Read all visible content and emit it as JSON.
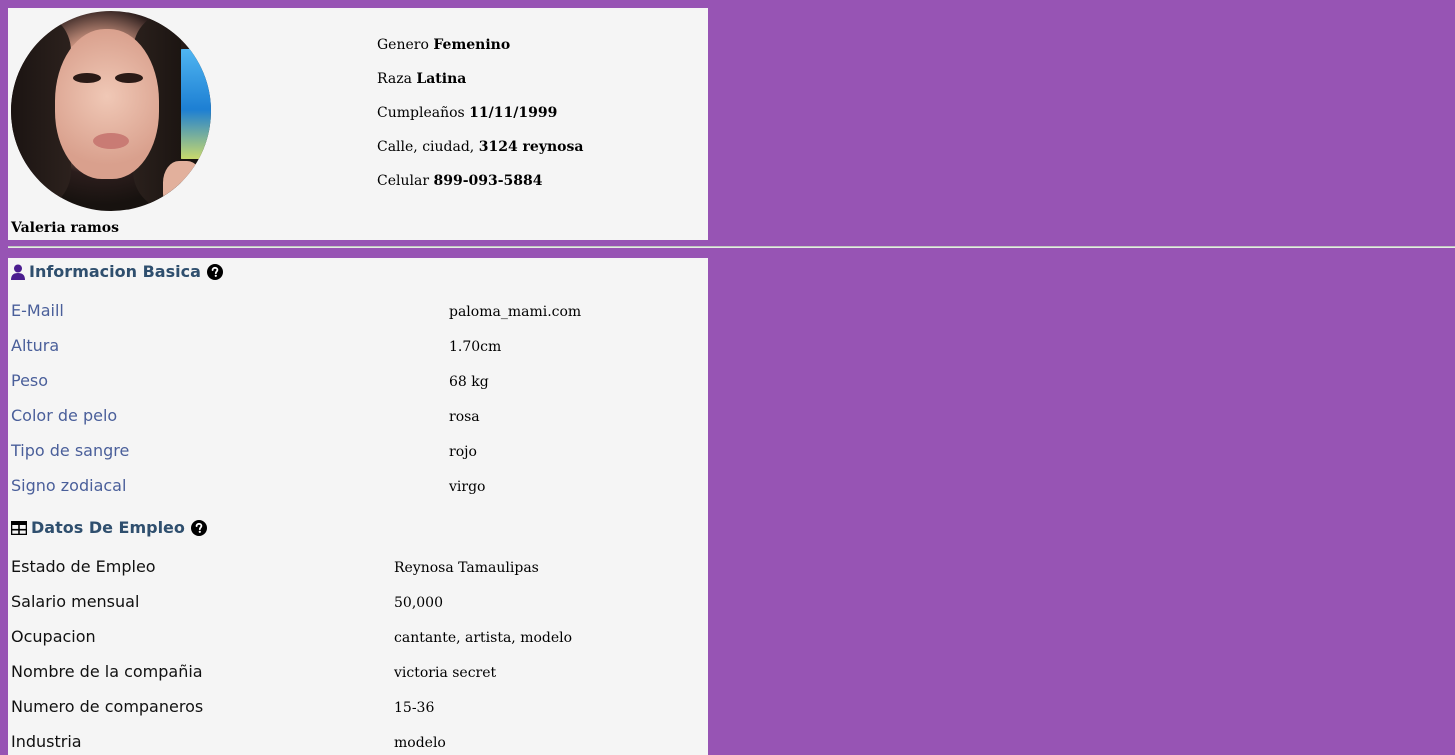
{
  "profile": {
    "name": "Valeria ramos",
    "details": [
      {
        "label": "Genero",
        "value": "Femenino"
      },
      {
        "label": "Raza",
        "value": "Latina"
      },
      {
        "label": "Cumpleaños",
        "value": "11/11/1999"
      },
      {
        "label": "Calle, ciudad,",
        "value": "3124 reynosa"
      },
      {
        "label": "Celular",
        "value": "899-093-5884"
      }
    ]
  },
  "basic_info": {
    "title": "Informacion Basica",
    "rows": [
      {
        "label": "E-Maill",
        "value": "paloma_mami.com"
      },
      {
        "label": "Altura",
        "value": "1.70cm"
      },
      {
        "label": "Peso",
        "value": "68 kg"
      },
      {
        "label": "Color de pelo",
        "value": "rosa"
      },
      {
        "label": "Tipo de sangre",
        "value": "rojo"
      },
      {
        "label": "Signo zodiacal",
        "value": "virgo"
      }
    ]
  },
  "employment": {
    "title": "Datos De Empleo",
    "rows": [
      {
        "label": "Estado de Empleo",
        "value": "Reynosa Tamaulipas"
      },
      {
        "label": "Salario mensual",
        "value": "50,000"
      },
      {
        "label": "Ocupacion",
        "value": "cantante, artista, modelo"
      },
      {
        "label": "Nombre de la compañia",
        "value": "victoria secret"
      },
      {
        "label": "Numero de companeros",
        "value": "15-36"
      },
      {
        "label": "Industria",
        "value": "modelo"
      }
    ]
  },
  "colors": {
    "background": "#9754b4",
    "card": "#f5f5f5",
    "section_title": "#2f4f6e",
    "basic_label": "#4a5f9a",
    "user_icon": "#4b1d8f"
  },
  "icons": {
    "basic": "user-icon",
    "employment": "table-icon",
    "help": "question-circle-icon"
  }
}
